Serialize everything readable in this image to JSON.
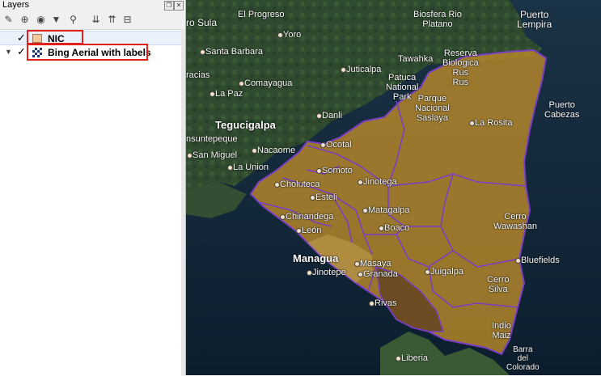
{
  "panel": {
    "title": "Layers",
    "window_controls": [
      {
        "icon": "restore-icon",
        "glyph": "❐"
      },
      {
        "icon": "close-icon",
        "glyph": "✕"
      }
    ],
    "toolbar": [
      {
        "icon": "style-icon",
        "glyph": "✎"
      },
      {
        "icon": "add-group-icon",
        "glyph": "⊕"
      },
      {
        "icon": "manage-visibility-icon",
        "glyph": "◉"
      },
      {
        "icon": "filter-icon",
        "glyph": "▼"
      },
      {
        "icon": "filter-legend-icon",
        "glyph": "⚲"
      },
      {
        "icon": "expand-all-icon",
        "glyph": "⇊"
      },
      {
        "icon": "collapse-all-icon",
        "glyph": "⇈"
      },
      {
        "icon": "remove-layer-icon",
        "glyph": "⊟"
      }
    ],
    "layers": [
      {
        "name": "NIC",
        "checked": true,
        "type": "vector",
        "icon": "polygon-layer-icon",
        "fill_color": "#f3c99e",
        "selected": true
      },
      {
        "name": "Bing Aerial with labels",
        "checked": true,
        "type": "raster",
        "icon": "raster-layer-icon",
        "expanded": true
      }
    ],
    "highlight_color": "#e3211b"
  },
  "map": {
    "country_fill": "#b8892a",
    "boundary_color": "#7b3fc4",
    "places": [
      {
        "name": "El Progreso",
        "big": false
      },
      {
        "name": "Biosfera Rio\nPlatano",
        "big": false
      },
      {
        "name": "Puerto\nLempira",
        "big": false
      },
      {
        "name": "ro Sula",
        "big": false
      },
      {
        "name": "Yoro",
        "big": false
      },
      {
        "name": "Santa Barbara",
        "big": false
      },
      {
        "name": "Tawahka",
        "big": false
      },
      {
        "name": "Reserva\nBiologica\nRus\nRus",
        "big": false
      },
      {
        "name": "racias",
        "big": false
      },
      {
        "name": "Juticalpa",
        "big": false
      },
      {
        "name": "Comayagua",
        "big": false
      },
      {
        "name": "Patuca\nNational\nPark",
        "big": false
      },
      {
        "name": "La Paz",
        "big": false
      },
      {
        "name": "Parque\nNacional\nSaslaya",
        "big": false
      },
      {
        "name": "Puerto\nCabezas",
        "big": false
      },
      {
        "name": "Danli",
        "big": false
      },
      {
        "name": "Tegucigalpa",
        "big": true
      },
      {
        "name": "La Rosita",
        "big": false
      },
      {
        "name": "nsuntepeque",
        "big": false
      },
      {
        "name": "Ocotal",
        "big": false
      },
      {
        "name": "Nacaome",
        "big": false
      },
      {
        "name": "San Miguel",
        "big": false
      },
      {
        "name": "La Union",
        "big": false
      },
      {
        "name": "Somoto",
        "big": false
      },
      {
        "name": "Choluteca",
        "big": false
      },
      {
        "name": "Jinotega",
        "big": false
      },
      {
        "name": "Esteli",
        "big": false
      },
      {
        "name": "Chinandega",
        "big": false
      },
      {
        "name": "Matagalpa",
        "big": false
      },
      {
        "name": "Cerro\nWawashan",
        "big": false
      },
      {
        "name": "Boaco",
        "big": false
      },
      {
        "name": "León",
        "big": false
      },
      {
        "name": "Managua",
        "big": true
      },
      {
        "name": "Bluefields",
        "big": false
      },
      {
        "name": "Masaya",
        "big": false
      },
      {
        "name": "Jinotepe",
        "big": false
      },
      {
        "name": "Granada",
        "big": false
      },
      {
        "name": "Juigalpa",
        "big": false
      },
      {
        "name": "Cerro\nSilva",
        "big": false
      },
      {
        "name": "Rivas",
        "big": false
      },
      {
        "name": "Indio\nMaiz",
        "big": false
      },
      {
        "name": "Liberia",
        "big": false
      },
      {
        "name": "Barra\ndel\nColorado",
        "big": false
      }
    ]
  }
}
